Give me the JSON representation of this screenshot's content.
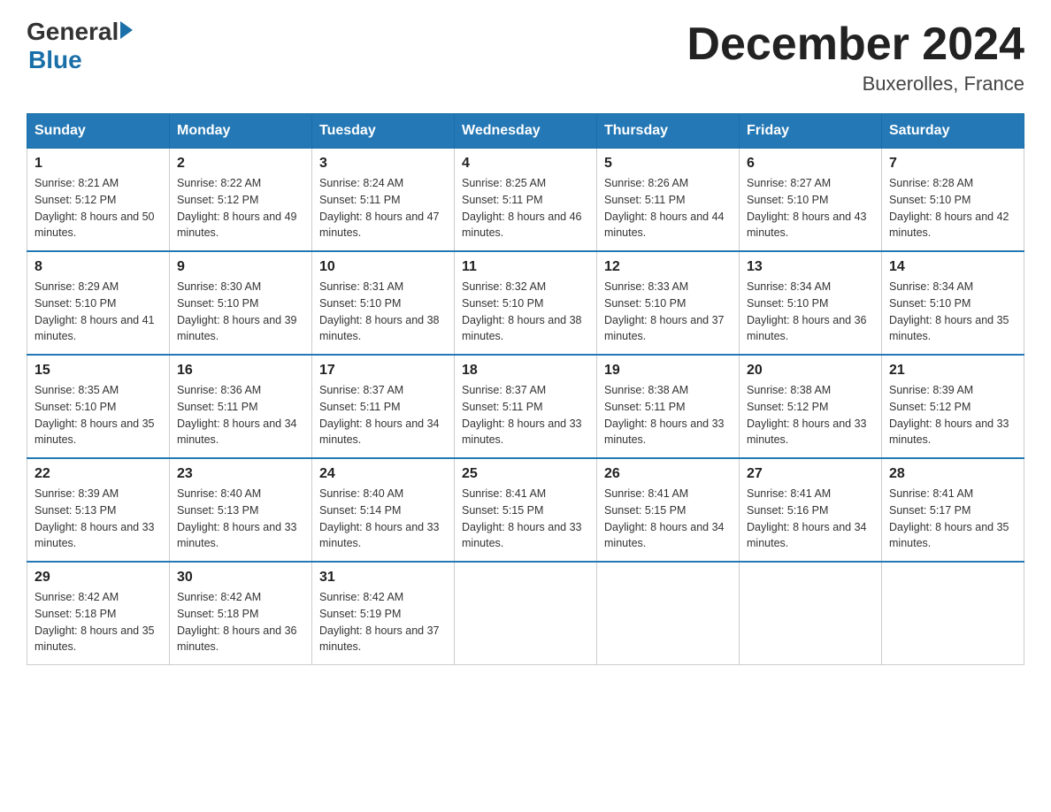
{
  "header": {
    "logo": {
      "general": "General",
      "blue": "Blue",
      "arrow_color": "#1a6fa8"
    },
    "title": "December 2024",
    "location": "Buxerolles, France"
  },
  "calendar": {
    "days_of_week": [
      "Sunday",
      "Monday",
      "Tuesday",
      "Wednesday",
      "Thursday",
      "Friday",
      "Saturday"
    ],
    "weeks": [
      [
        {
          "day": "1",
          "sunrise": "8:21 AM",
          "sunset": "5:12 PM",
          "daylight": "8 hours and 50 minutes."
        },
        {
          "day": "2",
          "sunrise": "8:22 AM",
          "sunset": "5:12 PM",
          "daylight": "8 hours and 49 minutes."
        },
        {
          "day": "3",
          "sunrise": "8:24 AM",
          "sunset": "5:11 PM",
          "daylight": "8 hours and 47 minutes."
        },
        {
          "day": "4",
          "sunrise": "8:25 AM",
          "sunset": "5:11 PM",
          "daylight": "8 hours and 46 minutes."
        },
        {
          "day": "5",
          "sunrise": "8:26 AM",
          "sunset": "5:11 PM",
          "daylight": "8 hours and 44 minutes."
        },
        {
          "day": "6",
          "sunrise": "8:27 AM",
          "sunset": "5:10 PM",
          "daylight": "8 hours and 43 minutes."
        },
        {
          "day": "7",
          "sunrise": "8:28 AM",
          "sunset": "5:10 PM",
          "daylight": "8 hours and 42 minutes."
        }
      ],
      [
        {
          "day": "8",
          "sunrise": "8:29 AM",
          "sunset": "5:10 PM",
          "daylight": "8 hours and 41 minutes."
        },
        {
          "day": "9",
          "sunrise": "8:30 AM",
          "sunset": "5:10 PM",
          "daylight": "8 hours and 39 minutes."
        },
        {
          "day": "10",
          "sunrise": "8:31 AM",
          "sunset": "5:10 PM",
          "daylight": "8 hours and 38 minutes."
        },
        {
          "day": "11",
          "sunrise": "8:32 AM",
          "sunset": "5:10 PM",
          "daylight": "8 hours and 38 minutes."
        },
        {
          "day": "12",
          "sunrise": "8:33 AM",
          "sunset": "5:10 PM",
          "daylight": "8 hours and 37 minutes."
        },
        {
          "day": "13",
          "sunrise": "8:34 AM",
          "sunset": "5:10 PM",
          "daylight": "8 hours and 36 minutes."
        },
        {
          "day": "14",
          "sunrise": "8:34 AM",
          "sunset": "5:10 PM",
          "daylight": "8 hours and 35 minutes."
        }
      ],
      [
        {
          "day": "15",
          "sunrise": "8:35 AM",
          "sunset": "5:10 PM",
          "daylight": "8 hours and 35 minutes."
        },
        {
          "day": "16",
          "sunrise": "8:36 AM",
          "sunset": "5:11 PM",
          "daylight": "8 hours and 34 minutes."
        },
        {
          "day": "17",
          "sunrise": "8:37 AM",
          "sunset": "5:11 PM",
          "daylight": "8 hours and 34 minutes."
        },
        {
          "day": "18",
          "sunrise": "8:37 AM",
          "sunset": "5:11 PM",
          "daylight": "8 hours and 33 minutes."
        },
        {
          "day": "19",
          "sunrise": "8:38 AM",
          "sunset": "5:11 PM",
          "daylight": "8 hours and 33 minutes."
        },
        {
          "day": "20",
          "sunrise": "8:38 AM",
          "sunset": "5:12 PM",
          "daylight": "8 hours and 33 minutes."
        },
        {
          "day": "21",
          "sunrise": "8:39 AM",
          "sunset": "5:12 PM",
          "daylight": "8 hours and 33 minutes."
        }
      ],
      [
        {
          "day": "22",
          "sunrise": "8:39 AM",
          "sunset": "5:13 PM",
          "daylight": "8 hours and 33 minutes."
        },
        {
          "day": "23",
          "sunrise": "8:40 AM",
          "sunset": "5:13 PM",
          "daylight": "8 hours and 33 minutes."
        },
        {
          "day": "24",
          "sunrise": "8:40 AM",
          "sunset": "5:14 PM",
          "daylight": "8 hours and 33 minutes."
        },
        {
          "day": "25",
          "sunrise": "8:41 AM",
          "sunset": "5:15 PM",
          "daylight": "8 hours and 33 minutes."
        },
        {
          "day": "26",
          "sunrise": "8:41 AM",
          "sunset": "5:15 PM",
          "daylight": "8 hours and 34 minutes."
        },
        {
          "day": "27",
          "sunrise": "8:41 AM",
          "sunset": "5:16 PM",
          "daylight": "8 hours and 34 minutes."
        },
        {
          "day": "28",
          "sunrise": "8:41 AM",
          "sunset": "5:17 PM",
          "daylight": "8 hours and 35 minutes."
        }
      ],
      [
        {
          "day": "29",
          "sunrise": "8:42 AM",
          "sunset": "5:18 PM",
          "daylight": "8 hours and 35 minutes."
        },
        {
          "day": "30",
          "sunrise": "8:42 AM",
          "sunset": "5:18 PM",
          "daylight": "8 hours and 36 minutes."
        },
        {
          "day": "31",
          "sunrise": "8:42 AM",
          "sunset": "5:19 PM",
          "daylight": "8 hours and 37 minutes."
        },
        null,
        null,
        null,
        null
      ]
    ]
  }
}
